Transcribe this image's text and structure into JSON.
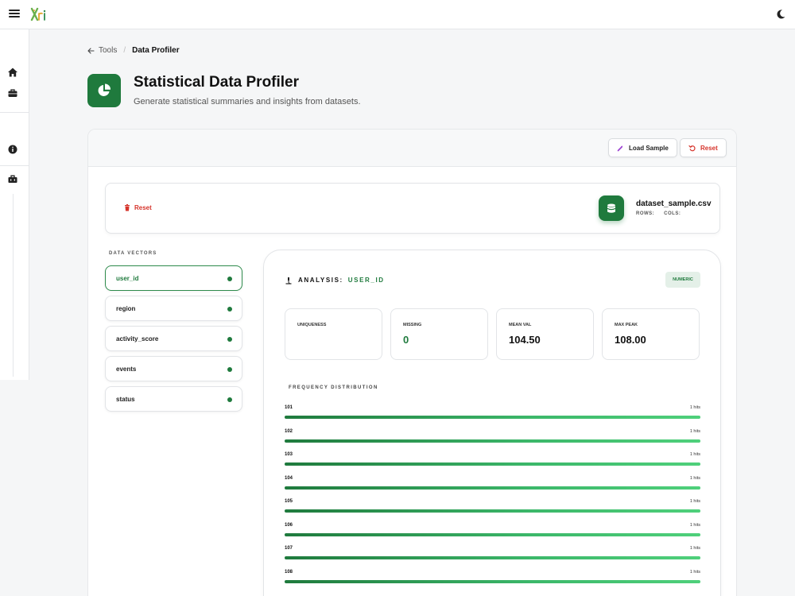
{
  "topbar": {
    "menu_icon": "hamburger-menu-icon",
    "logo_icon": "app-logo-icon",
    "theme_icon": "moon-icon"
  },
  "sidebar": {
    "icons": [
      "home-icon",
      "briefcase-icon",
      "info-icon",
      "toolbox-icon"
    ]
  },
  "breadcrumb": {
    "back_label": "Tools",
    "separator": "/",
    "current": "Data Profiler"
  },
  "hero": {
    "title": "Statistical Data Profiler",
    "subtitle": "Generate statistical summaries and insights from datasets.",
    "icon": "pie-chart-icon"
  },
  "toolbar": {
    "load_sample_label": "Load Sample",
    "reset_label": "Reset"
  },
  "file": {
    "reset_label": "Reset",
    "name": "dataset_sample.csv",
    "rows_label": "ROWS:",
    "cols_label": "COLS:"
  },
  "vectors": {
    "label": "DATA VECTORS",
    "items": [
      {
        "label": "user_id",
        "active": true
      },
      {
        "label": "region",
        "active": false
      },
      {
        "label": "activity_score",
        "active": false
      },
      {
        "label": "events",
        "active": false
      },
      {
        "label": "status",
        "active": false
      }
    ]
  },
  "analysis": {
    "prefix": "ANALYSIS:",
    "field": "USER_ID",
    "type_badge": "NUMERIC",
    "stats": [
      {
        "label": "UNIQUENESS",
        "value": ""
      },
      {
        "label": "MISSING",
        "value": "0"
      },
      {
        "label": "MEAN VAL",
        "value": "104.50"
      },
      {
        "label": "MAX PEAK",
        "value": "108.00"
      }
    ],
    "frequency_label": "FREQUENCY DISTRIBUTION",
    "frequency": [
      {
        "value": "101",
        "hits": "1 hits",
        "fill": 1.0
      },
      {
        "value": "102",
        "hits": "1 hits",
        "fill": 1.0
      },
      {
        "value": "103",
        "hits": "1 hits",
        "fill": 1.0
      },
      {
        "value": "104",
        "hits": "1 hits",
        "fill": 1.0
      },
      {
        "value": "105",
        "hits": "1 hits",
        "fill": 1.0
      },
      {
        "value": "106",
        "hits": "1 hits",
        "fill": 1.0
      },
      {
        "value": "107",
        "hits": "1 hits",
        "fill": 1.0
      },
      {
        "value": "108",
        "hits": "1 hits",
        "fill": 1.0
      }
    ]
  },
  "colors": {
    "accent": "#1f7a3d",
    "accent_light": "#4fd07b",
    "danger": "#d6342b",
    "badge_bg": "#e4f0e8"
  }
}
